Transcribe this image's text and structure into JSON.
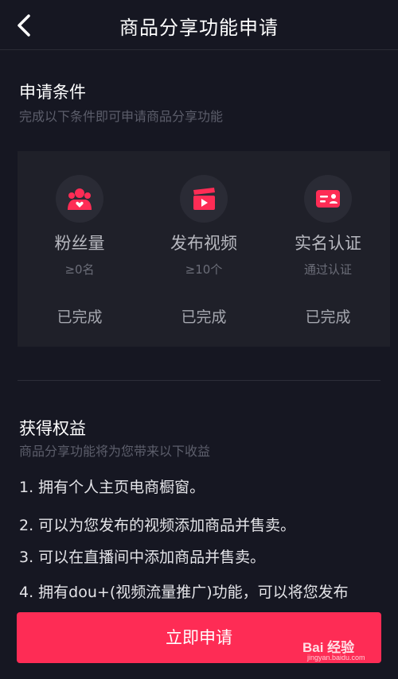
{
  "nav": {
    "title": "商品分享功能申请"
  },
  "conditions": {
    "title": "申请条件",
    "subtitle": "完成以下条件即可申请商品分享功能",
    "items": [
      {
        "icon": "fans-icon",
        "title": "粉丝量",
        "requirement": "≥0名",
        "status": "已完成"
      },
      {
        "icon": "video-clapper-icon",
        "title": "发布视频",
        "requirement": "≥10个",
        "status": "已完成"
      },
      {
        "icon": "id-card-icon",
        "title": "实名认证",
        "requirement": "通过认证",
        "status": "已完成"
      }
    ]
  },
  "benefits": {
    "title": "获得权益",
    "subtitle": "商品分享功能将为您带来以下收益",
    "items": [
      "1. 拥有个人主页电商橱窗。",
      "2. 可以为您发布的视频添加商品并售卖。",
      "3. 可以在直播间中添加商品并售卖。",
      "4. 拥有dou+(视频流量推广)功能，可以将您发布"
    ]
  },
  "apply_button": {
    "label": "立即申请"
  },
  "watermark": {
    "brand": "Bai  经验",
    "url": "jingyan.baidu.com"
  },
  "colors": {
    "accent": "#fe2c55",
    "background": "#161722",
    "card": "#1f2029"
  }
}
